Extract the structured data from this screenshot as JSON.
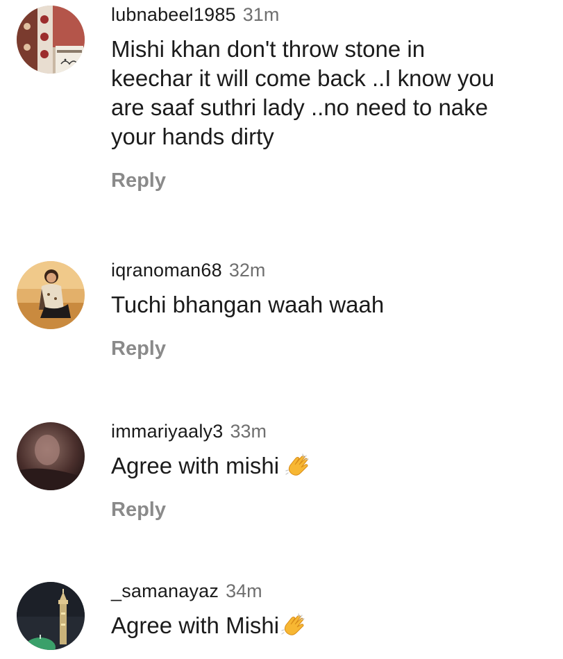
{
  "comments": [
    {
      "username": "lubnabeel1985",
      "time": "31m",
      "text_lines": [
        "Mishi khan don't throw stone in",
        "keechar it will come back ..I know you",
        "are saaf suthri lady ..no need to nake",
        "your hands dirty"
      ],
      "reply_label": "Reply",
      "avatar_icon": "avatar-photo-textile"
    },
    {
      "username": "iqranoman68",
      "time": "32m",
      "text": "Tuchi bhangan waah waah",
      "reply_label": "Reply",
      "avatar_icon": "avatar-photo-woman-seated"
    },
    {
      "username": "immariyaaly3",
      "time": "33m",
      "text": "Agree with mishi",
      "emoji": "clapping-hands-icon",
      "reply_label": "Reply",
      "avatar_icon": "avatar-photo-dark-portrait"
    },
    {
      "username": "_samanayaz",
      "time": "34m",
      "text": "Agree with Mishi",
      "emoji": "clapping-hands-icon",
      "avatar_icon": "avatar-photo-minaret"
    }
  ],
  "colors": {
    "text": "#1a1a1a",
    "timestamp": "#6f6f6f",
    "reply": "#8a8a8a",
    "emoji": "#f7b733"
  }
}
